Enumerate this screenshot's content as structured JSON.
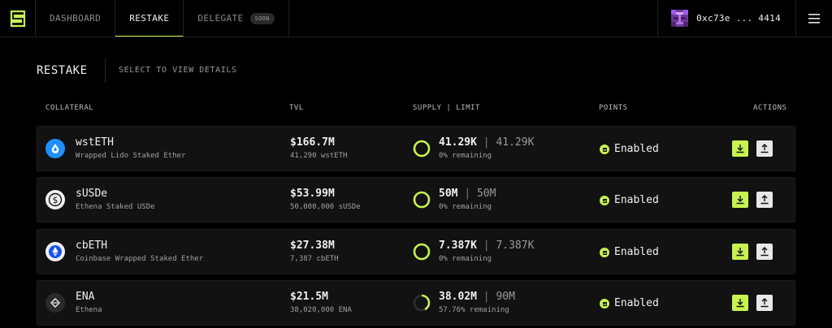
{
  "nav": {
    "tabs": [
      {
        "label": "DASHBOARD"
      },
      {
        "label": "RESTAKE"
      },
      {
        "label": "DELEGATE",
        "badge": "SOON"
      }
    ],
    "wallet": "0xc73e ... 4414"
  },
  "section": {
    "title": "RESTAKE",
    "subtitle": "SELECT TO VIEW DETAILS"
  },
  "columns": {
    "collateral": "COLLATERAL",
    "tvl": "TVL",
    "supply": "SUPPLY | LIMIT",
    "points": "POINTS",
    "actions": "ACTIONS"
  },
  "rows": [
    {
      "symbol": "wstETH",
      "name": "Wrapped Lido Staked Ether",
      "icon": "lido-drop-icon",
      "tvl": "$166.7M",
      "tvl_amount": "41,290 wstETH",
      "supply": "41.29K",
      "limit": "41.29K",
      "remaining": "0% remaining",
      "fill": 1.0,
      "points": "Enabled"
    },
    {
      "symbol": "sUSDe",
      "name": "Ethena Staked USDe",
      "icon": "dollar-coin-icon",
      "tvl": "$53.99M",
      "tvl_amount": "50,000,000 sUSDe",
      "supply": "50M",
      "limit": "50M",
      "remaining": "0% remaining",
      "fill": 1.0,
      "points": "Enabled"
    },
    {
      "symbol": "cbETH",
      "name": "Coinbase Wrapped Staked Ether",
      "icon": "ethereum-icon",
      "tvl": "$27.38M",
      "tvl_amount": "7,387 cbETH",
      "supply": "7.387K",
      "limit": "7.387K",
      "remaining": "0% remaining",
      "fill": 1.0,
      "points": "Enabled"
    },
    {
      "symbol": "ENA",
      "name": "Ethena",
      "icon": "ethena-icon",
      "tvl": "$21.5M",
      "tvl_amount": "38,020,000 ENA",
      "supply": "38.02M",
      "limit": "90M",
      "remaining": "57.76% remaining",
      "fill": 0.4224,
      "points": "Enabled"
    }
  ],
  "colors": {
    "accent": "#c8f250",
    "row_bg": "#121212",
    "page_bg": "#000000"
  }
}
